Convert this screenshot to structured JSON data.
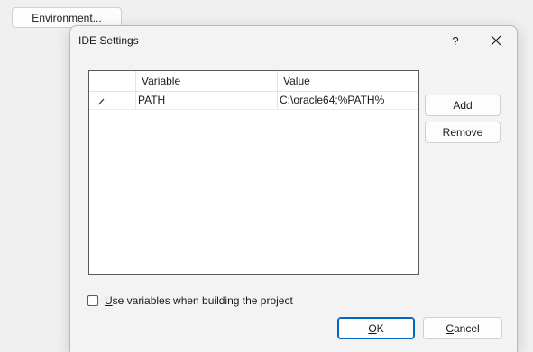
{
  "background": {
    "environment_button": {
      "accel": "E",
      "rest": "nvironment..."
    }
  },
  "dialog": {
    "title": "IDE Settings",
    "help_label": "?",
    "close_icon": "close-icon",
    "grid": {
      "columns": [
        "",
        "Variable",
        "Value"
      ],
      "rows": [
        {
          "marker_icon": "pencil-edit-icon",
          "variable": "PATH",
          "value": "C:\\oracle64;%PATH%"
        }
      ]
    },
    "add_label": "Add",
    "remove_label": "Remove",
    "checkbox": {
      "checked": false,
      "accel": "U",
      "rest": "se variables when building the project"
    },
    "ok": {
      "accel": "O",
      "rest": "K"
    },
    "cancel": {
      "accel": "C",
      "rest": "ancel"
    }
  },
  "colors": {
    "accent": "#0067c0",
    "dialog_bg": "#f3f3f3",
    "grid_border": "#5a5a5a"
  }
}
